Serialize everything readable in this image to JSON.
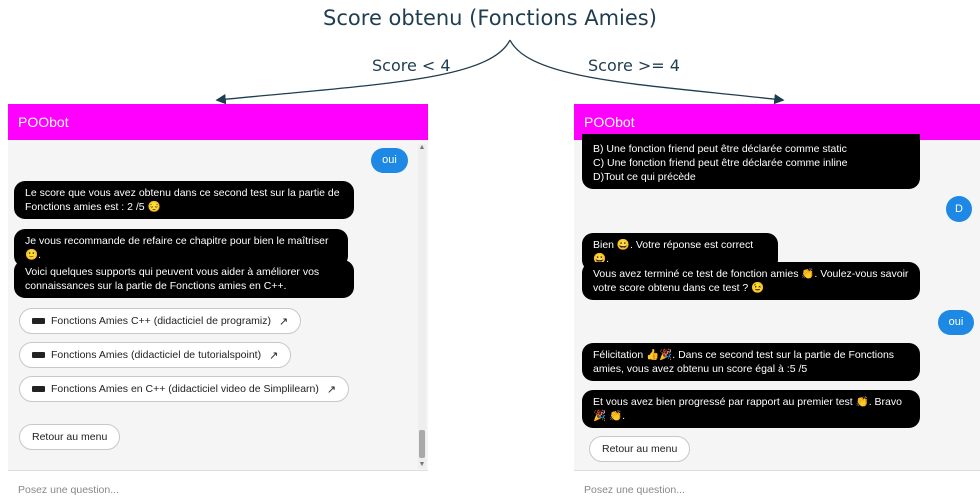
{
  "diagram": {
    "title": "Score obtenu (Fonctions Amies)",
    "branch_left": "Score < 4",
    "branch_right": "Score >= 4"
  },
  "left_panel": {
    "header": "POObot",
    "user_reply": "oui",
    "messages": [
      "Le score que vous avez obtenu dans ce second test sur la partie de Fonctions amies est : 2 /5 😔",
      "Je vous recommande de refaire ce chapitre pour bien le maîtriser 🙂.",
      "Voici quelques supports qui peuvent vous aider à améliorer vos connaissances sur la partie de Fonctions amies en C++."
    ],
    "links": [
      "Fonctions Amies C++ (didacticiel de programiz)",
      "Fonctions Amies (didacticiel de tutorialspoint)",
      "Fonctions Amies en C++ (didacticiel video de Simplilearn)"
    ],
    "menu_button": "Retour au menu",
    "input_placeholder": "Posez une question..."
  },
  "right_panel": {
    "header": "POObot",
    "options_lines": [
      "B) Une fonction friend peut être déclarée comme static",
      "C) Une fonction friend peut être déclarée comme inline",
      "D)Tout ce qui précède"
    ],
    "user_answer": "D",
    "messages": [
      "Bien 😀. Votre réponse est correct 😀.",
      "Vous avez terminé ce test de fonction amies 👏. Voulez-vous savoir votre score obtenu dans ce test ? 😉",
      "Félicitation 👍🎉. Dans ce second test sur la partie de Fonctions amies, vous avez obtenu un score égal à :5 /5",
      "Et vous avez bien progressé par rapport au premier test 👏. Bravo 🎉 👏."
    ],
    "user_reply": "oui",
    "menu_button": "Retour au menu",
    "input_placeholder": "Posez une question..."
  },
  "colors": {
    "header": "#ff00ff",
    "bot_bubble": "#000000",
    "user_bubble": "#1e88e5",
    "diagram_text": "#1f3d50"
  },
  "icons": {
    "link_icon": "video-thumbnail-icon",
    "external": "external-link-icon"
  }
}
